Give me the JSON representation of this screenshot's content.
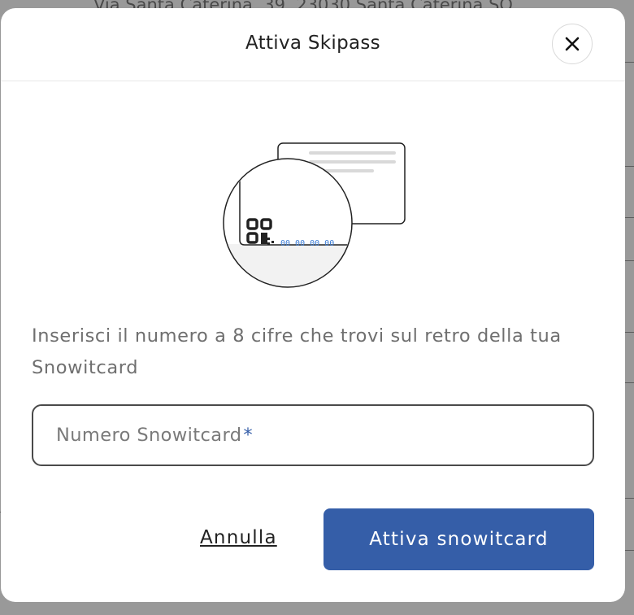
{
  "background": {
    "address": "Via Santa Caterina, 39, 23030 Santa Caterina SO"
  },
  "modal": {
    "title": "Attiva Skipass",
    "illustration": {
      "card_number": "00 00 00 00"
    },
    "instruction": "Inserisci il numero a 8 cifre che trovi sul retro della tua Snowitcard",
    "field": {
      "placeholder": "Numero Snowitcard",
      "required_mark": "*"
    },
    "cancel_label": "Annulla",
    "submit_label": "Attiva snowitcard"
  },
  "colors": {
    "primary": "#355ea8",
    "overlay": "rgba(0,0,0,0.40)",
    "card_number": "#3a7bd5"
  },
  "icons": {
    "close": "close-icon",
    "illustration": "snowitcard-qr-illustration"
  }
}
